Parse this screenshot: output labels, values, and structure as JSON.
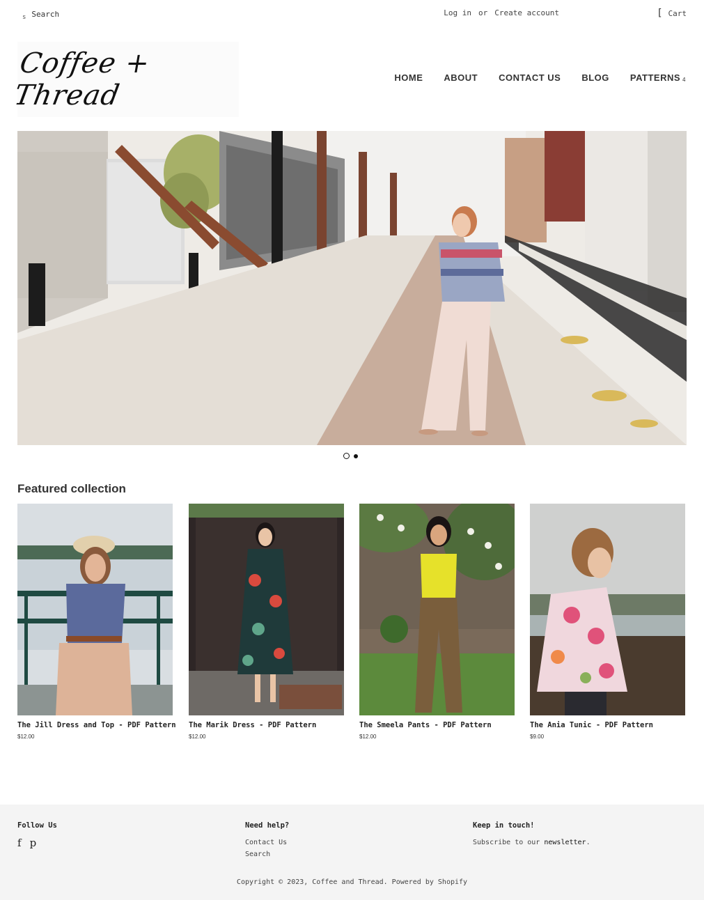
{
  "topbar": {
    "search_icon": "s",
    "search_placeholder": "Search",
    "login": "Log in",
    "or": "or",
    "create_account": "Create account",
    "cart_icon": "[",
    "cart": "Cart"
  },
  "header": {
    "logo": "Coffee + Thread",
    "nav": {
      "home": "HOME",
      "about": "ABOUT",
      "contact": "CONTACT US",
      "blog": "BLOG",
      "patterns": "PATTERNS",
      "patterns_caret": "4"
    }
  },
  "hero": {
    "slide_count": 2,
    "active_slide": 1
  },
  "featured": {
    "title": "Featured collection",
    "products": [
      {
        "title": "The Jill Dress and Top - PDF Pattern",
        "price": "$12.00"
      },
      {
        "title": "The Marik Dress - PDF Pattern",
        "price": "$12.00"
      },
      {
        "title": "The Smeela Pants - PDF Pattern",
        "price": "$12.00"
      },
      {
        "title": "The Ania Tunic - PDF Pattern",
        "price": "$9.00"
      }
    ]
  },
  "footer": {
    "follow_title": "Follow Us",
    "social": {
      "facebook": "f",
      "pinterest": "p"
    },
    "help_title": "Need help?",
    "help_links": {
      "contact": "Contact Us",
      "search": "Search"
    },
    "touch_title": "Keep in touch!",
    "touch_text": "Subscribe to our",
    "newsletter": "newsletter",
    "touch_end": ".",
    "copyright": "Copyright © 2023, Coffee and Thread. Powered by Shopify"
  }
}
